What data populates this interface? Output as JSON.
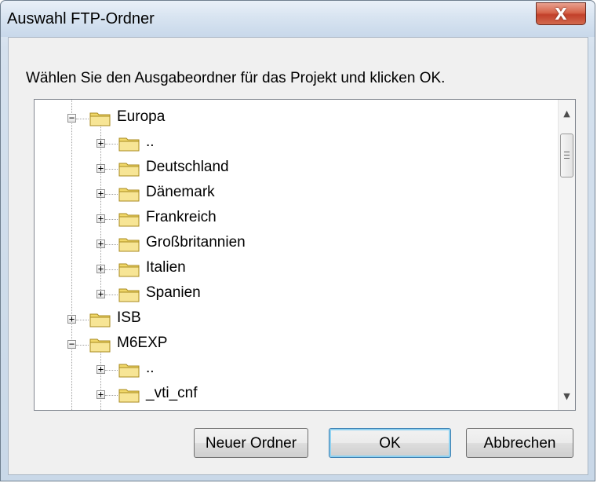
{
  "window": {
    "title": "Auswahl FTP-Ordner",
    "close_glyph": "X"
  },
  "prompt": "Wählen Sie den Ausgabeordner für das Projekt und klicken OK.",
  "tree": [
    {
      "label": "Europa",
      "expander": "−"
    },
    {
      "label": "..",
      "expander": "+"
    },
    {
      "label": "Deutschland",
      "expander": "+"
    },
    {
      "label": "Dänemark",
      "expander": "+"
    },
    {
      "label": "Frankreich",
      "expander": "+"
    },
    {
      "label": "Großbritannien",
      "expander": "+"
    },
    {
      "label": "Italien",
      "expander": "+"
    },
    {
      "label": "Spanien",
      "expander": "+"
    },
    {
      "label": "ISB",
      "expander": "+"
    },
    {
      "label": "M6EXP",
      "expander": "−"
    },
    {
      "label": "..",
      "expander": "+"
    },
    {
      "label": "_vti_cnf",
      "expander": "+"
    }
  ],
  "scrollbar": {
    "up_glyph": "▲",
    "down_glyph": "▼"
  },
  "buttons": {
    "new_folder": "Neuer Ordner",
    "ok": "OK",
    "cancel": "Abbrechen"
  },
  "colors": {
    "folder": "#f1d86a",
    "close_button": "#c9472f",
    "default_button_border": "#3c7fb1"
  }
}
